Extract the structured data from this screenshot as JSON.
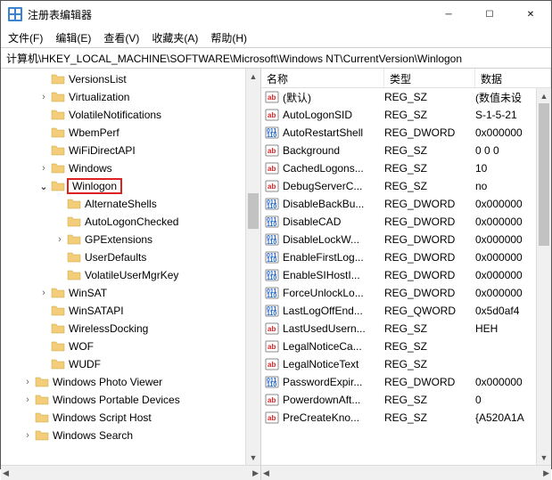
{
  "window": {
    "title": "注册表编辑器"
  },
  "menu": {
    "file": "文件(F)",
    "edit": "编辑(E)",
    "view": "查看(V)",
    "favorites": "收藏夹(A)",
    "help": "帮助(H)"
  },
  "address": "计算机\\HKEY_LOCAL_MACHINE\\SOFTWARE\\Microsoft\\Windows NT\\CurrentVersion\\Winlogon",
  "tree": [
    {
      "indent": 5,
      "exp": "",
      "label": "VersionsList"
    },
    {
      "indent": 5,
      "exp": ">",
      "label": "Virtualization"
    },
    {
      "indent": 5,
      "exp": "",
      "label": "VolatileNotifications"
    },
    {
      "indent": 5,
      "exp": "",
      "label": "WbemPerf"
    },
    {
      "indent": 5,
      "exp": "",
      "label": "WiFiDirectAPI"
    },
    {
      "indent": 5,
      "exp": ">",
      "label": "Windows"
    },
    {
      "indent": 5,
      "exp": "v",
      "label": "Winlogon",
      "hl": true
    },
    {
      "indent": 6,
      "exp": "",
      "label": "AlternateShells"
    },
    {
      "indent": 6,
      "exp": "",
      "label": "AutoLogonChecked"
    },
    {
      "indent": 6,
      "exp": ">",
      "label": "GPExtensions"
    },
    {
      "indent": 6,
      "exp": "",
      "label": "UserDefaults"
    },
    {
      "indent": 6,
      "exp": "",
      "label": "VolatileUserMgrKey"
    },
    {
      "indent": 5,
      "exp": ">",
      "label": "WinSAT"
    },
    {
      "indent": 5,
      "exp": "",
      "label": "WinSATAPI"
    },
    {
      "indent": 5,
      "exp": "",
      "label": "WirelessDocking"
    },
    {
      "indent": 5,
      "exp": "",
      "label": "WOF"
    },
    {
      "indent": 5,
      "exp": "",
      "label": "WUDF"
    },
    {
      "indent": 4,
      "exp": ">",
      "label": "Windows Photo Viewer"
    },
    {
      "indent": 4,
      "exp": ">",
      "label": "Windows Portable Devices"
    },
    {
      "indent": 4,
      "exp": "",
      "label": "Windows Script Host"
    },
    {
      "indent": 4,
      "exp": ">",
      "label": "Windows Search"
    }
  ],
  "list": {
    "headers": {
      "name": "名称",
      "type": "类型",
      "data": "数据"
    },
    "rows": [
      {
        "icon": "sz",
        "name": "(默认)",
        "type": "REG_SZ",
        "data": "(数值未设"
      },
      {
        "icon": "sz",
        "name": "AutoLogonSID",
        "type": "REG_SZ",
        "data": "S-1-5-21"
      },
      {
        "icon": "dw",
        "name": "AutoRestartShell",
        "type": "REG_DWORD",
        "data": "0x000000"
      },
      {
        "icon": "sz",
        "name": "Background",
        "type": "REG_SZ",
        "data": "0 0 0"
      },
      {
        "icon": "sz",
        "name": "CachedLogons...",
        "type": "REG_SZ",
        "data": "10"
      },
      {
        "icon": "sz",
        "name": "DebugServerC...",
        "type": "REG_SZ",
        "data": "no"
      },
      {
        "icon": "dw",
        "name": "DisableBackBu...",
        "type": "REG_DWORD",
        "data": "0x000000"
      },
      {
        "icon": "dw",
        "name": "DisableCAD",
        "type": "REG_DWORD",
        "data": "0x000000"
      },
      {
        "icon": "dw",
        "name": "DisableLockW...",
        "type": "REG_DWORD",
        "data": "0x000000"
      },
      {
        "icon": "dw",
        "name": "EnableFirstLog...",
        "type": "REG_DWORD",
        "data": "0x000000"
      },
      {
        "icon": "dw",
        "name": "EnableSIHostI...",
        "type": "REG_DWORD",
        "data": "0x000000"
      },
      {
        "icon": "dw",
        "name": "ForceUnlockLo...",
        "type": "REG_DWORD",
        "data": "0x000000"
      },
      {
        "icon": "dw",
        "name": "LastLogOffEnd...",
        "type": "REG_QWORD",
        "data": "0x5d0af4"
      },
      {
        "icon": "sz",
        "name": "LastUsedUsern...",
        "type": "REG_SZ",
        "data": "HEH"
      },
      {
        "icon": "sz",
        "name": "LegalNoticeCa...",
        "type": "REG_SZ",
        "data": ""
      },
      {
        "icon": "sz",
        "name": "LegalNoticeText",
        "type": "REG_SZ",
        "data": ""
      },
      {
        "icon": "dw",
        "name": "PasswordExpir...",
        "type": "REG_DWORD",
        "data": "0x000000"
      },
      {
        "icon": "sz",
        "name": "PowerdownAft...",
        "type": "REG_SZ",
        "data": "0"
      },
      {
        "icon": "sz",
        "name": "PreCreateKno...",
        "type": "REG_SZ",
        "data": "{A520A1A"
      }
    ]
  }
}
